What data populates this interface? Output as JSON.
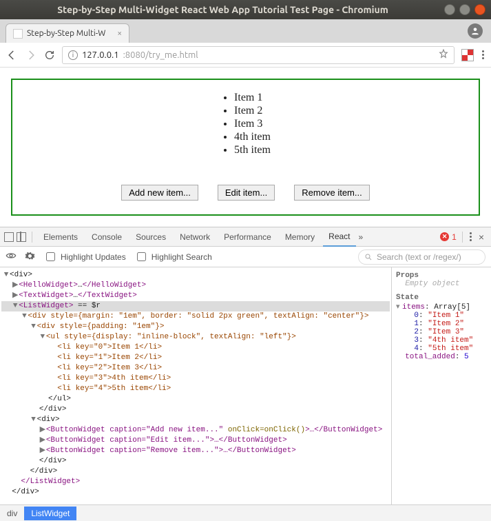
{
  "window": {
    "title": "Step-by-Step Multi-Widget React Web App Tutorial Test Page - Chromium",
    "tab_title": "Step-by-Step Multi-W"
  },
  "url": {
    "host": "127.0.0.1",
    "port_path": ":8080/try_me.html"
  },
  "list": {
    "items": [
      "Item 1",
      "Item 2",
      "Item 3",
      "4th item",
      "5th item"
    ],
    "buttons": {
      "add": "Add new item...",
      "edit": "Edit item...",
      "remove": "Remove item..."
    }
  },
  "devtools": {
    "tabs": [
      "Elements",
      "Console",
      "Sources",
      "Network",
      "Performance",
      "Memory",
      "React"
    ],
    "active_tab": "React",
    "errors": "1",
    "toolbar2": {
      "hl_updates": "Highlight Updates",
      "hl_search": "Highlight Search",
      "search_ph": "Search (text or /regex/)"
    },
    "tree": {
      "root_open": "<div>",
      "hello": {
        "open": "<HelloWidget>",
        "dots": "…",
        "close": "</HelloWidget>"
      },
      "text": {
        "open": "<TextWidget>",
        "dots": "…",
        "close": "</TextWidget>"
      },
      "listw": {
        "open": "<ListWidget>",
        "anno": " == $r",
        "outer_div": "<div style={margin: \"1em\", border: \"solid 2px green\", textAlign: \"center\"}>",
        "inner_div": "<div style={padding: \"1em\"}>",
        "ul_open": "<ul style={display: \"inline-block\", textAlign: \"left\"}>",
        "lis": [
          "<li key=\"0\">Item 1</li>",
          "<li key=\"1\">Item 2</li>",
          "<li key=\"2\">Item 3</li>",
          "<li key=\"3\">4th item</li>",
          "<li key=\"4\">5th item</li>"
        ],
        "ul_close": "</ul>",
        "div_close": "</div>",
        "div2_open": "<div>",
        "btn1_a": "<ButtonWidget caption=\"Add new item...\" ",
        "btn1_b": "onClick=onClick()",
        "btn1_c": ">…</ButtonWidget>",
        "btn2": "<ButtonWidget caption=\"Edit item...\">…</ButtonWidget>",
        "btn3": "<ButtonWidget caption=\"Remove item...\">…</ButtonWidget>",
        "div2_close": "</div>",
        "outer_close": "</div>",
        "close": "</ListWidget>"
      },
      "root_close": "</div>"
    },
    "props": {
      "hdr": "Props",
      "empty": "Empty object"
    },
    "state": {
      "hdr": "State",
      "items_label": "items",
      "items_val": "Array[5]",
      "entries": [
        {
          "k": "0",
          "v": "\"Item 1\""
        },
        {
          "k": "1",
          "v": "\"Item 2\""
        },
        {
          "k": "2",
          "v": "\"Item 3\""
        },
        {
          "k": "3",
          "v": "\"4th item\""
        },
        {
          "k": "4",
          "v": "\"5th item\""
        }
      ],
      "total_label": "total_added",
      "total_val": "5"
    },
    "crumbs": [
      "div",
      "ListWidget"
    ]
  }
}
